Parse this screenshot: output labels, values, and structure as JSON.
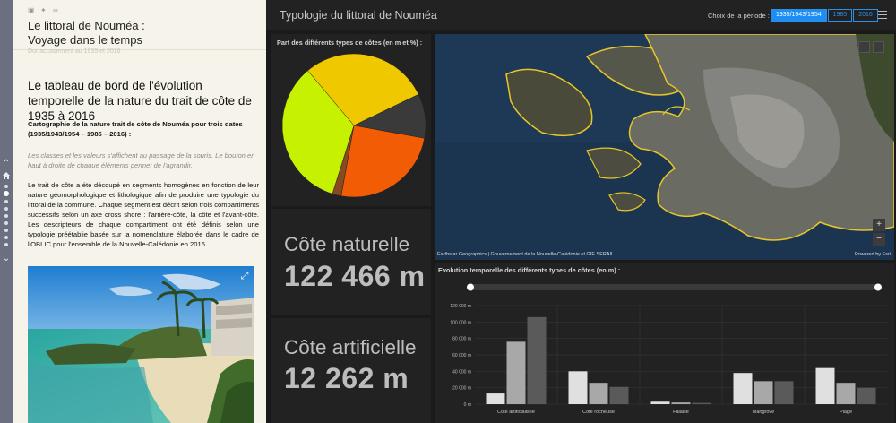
{
  "nav": {
    "up_icon": "chevron-up-icon",
    "down_icon": "chevron-down-icon",
    "home_icon": "home-icon"
  },
  "story": {
    "share_icons": [
      "facebook-icon",
      "twitter-icon",
      "link-icon"
    ],
    "title_line1": "Le littoral de Nouméa :",
    "title_line2": "Voyage dans le temps",
    "faded_text": "Dur accasement au 1935 et 2016",
    "section_title": "Le tableau de bord de l'évolution temporelle de la nature du trait de côte de 1935 à 2016",
    "bold_paragraph": "Cartographie de la nature trait de côte de Nouméa pour trois dates (1935/1943/1954 – 1985 – 2016) :",
    "italic_paragraph": "Les classes et les valeurs s'affichent au passage de la souris. Le bouton en haut à droite de chaque éléments permet de l'agrandir.",
    "body_paragraph": "Le trait de côte a été découpé en segments homogènes en fonction de leur nature géomorphologique et lithologique afin de produire une typologie du littoral de la commune. Chaque segment est décrit selon trois compartiments successifs selon un axe cross shore : l'arrière-côte, la côte et l'avant-côte. Les descripteurs de chaque compartiment ont été définis selon une typologie préétablie basée sur la nomenclature élaborée dans le cadre de l'OBLIC pour l'ensemble de la Nouvelle-Calédonie en 2016."
  },
  "dashboard": {
    "title": "Typologie du littoral de Nouméa",
    "period_label": "Choix de la période :",
    "periods": [
      "1935/1943/1954",
      "1985",
      "2016"
    ],
    "active_period": "1935/1943/1954",
    "pie_title": "Part des différents types de côtes (en m et %) :",
    "kpi1_label": "Côte naturelle",
    "kpi1_value": "122 466 m",
    "kpi2_label": "Côte artificielle",
    "kpi2_value": "12 262 m",
    "map_attribution": "Earthstar Geographics | Gouvernement de la Nouvelle-Calédonie et GIE SERAIL",
    "map_powered": "Powered by Esri",
    "bar_title": "Evolution temporelle des différents types de côtes (en m) :"
  },
  "colors": {
    "accent": "#1d8ef5",
    "pie": [
      "#f0c800",
      "#3a3a3a",
      "#f25c05",
      "#8a4a20",
      "#c6f202"
    ],
    "bar_periods": [
      "#e0e0e0",
      "#a8a8a8",
      "#5a5a5a"
    ]
  },
  "chart_data": [
    {
      "type": "pie",
      "title": "Part des différents types de côtes (en m et %) :",
      "slices": [
        {
          "value": 29
        },
        {
          "value": 10
        },
        {
          "value": 25
        },
        {
          "value": 2
        },
        {
          "value": 34
        }
      ]
    },
    {
      "type": "bar",
      "title": "Evolution temporelle des différents types de côtes (en m) :",
      "categories": [
        "Côte artificialisée",
        "Côte rocheuse",
        "Falaise",
        "Mangrove",
        "Plage"
      ],
      "series": [
        {
          "values": [
            13000,
            40000,
            3000,
            38000,
            44000
          ]
        },
        {
          "values": [
            76000,
            26000,
            2000,
            28000,
            26000
          ]
        },
        {
          "values": [
            106000,
            21000,
            1500,
            28000,
            20000
          ]
        }
      ],
      "ylim": [
        0,
        120000
      ],
      "yticks": [
        "0 m",
        "20 000 m",
        "40 000 m",
        "60 000 m",
        "80 000 m",
        "100 000 m",
        "120 000 m"
      ]
    }
  ]
}
